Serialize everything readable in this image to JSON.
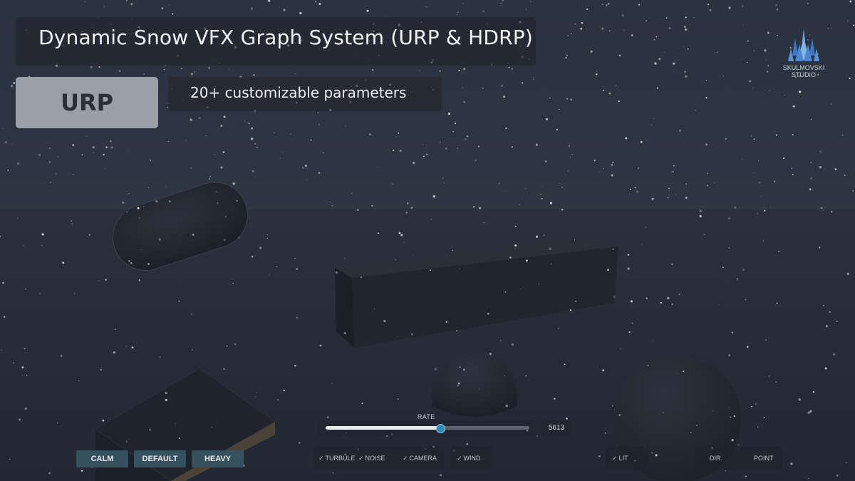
{
  "header": {
    "title": "Dynamic Snow VFX Graph System (URP & HDRP)",
    "pipeline_badge": "URP",
    "subtitle": "20+ customizable parameters"
  },
  "logo": {
    "line1": "SKULMOVSKI",
    "line2": "STUDIO",
    "icon": "crystal-crown-icon"
  },
  "rate": {
    "label": "RATE",
    "value": "5613",
    "fraction": 0.56
  },
  "presets": [
    "CALM",
    "DEFAULT",
    "HEAVY"
  ],
  "toggles": {
    "turbulence": "TURBULE",
    "noise": "NOISE",
    "camera": "CAMERA",
    "wind": "WIND",
    "lit": "LIT",
    "check_icon": "check-icon"
  },
  "lights": {
    "dir": "DIR",
    "point": "POINT"
  },
  "colors": {
    "accent": "#2e8bb8",
    "preset_button": "#36505e",
    "badge": "#9aa0a8"
  }
}
